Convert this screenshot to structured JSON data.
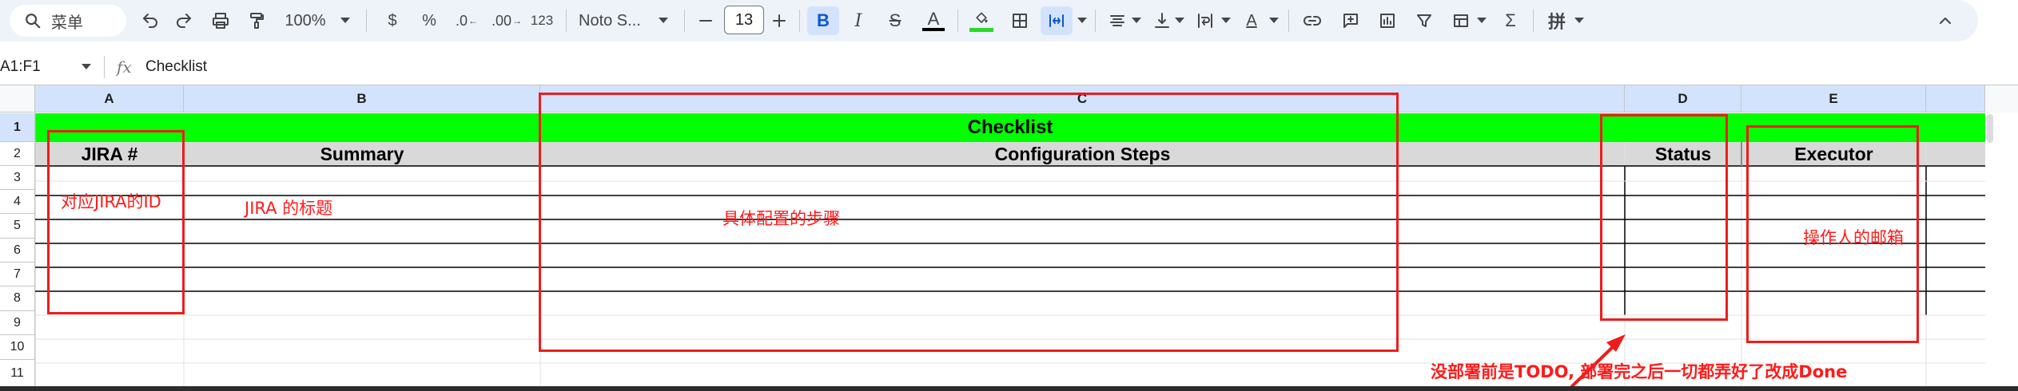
{
  "toolbar": {
    "menu_search_label": "菜单",
    "zoom": "100%",
    "currency": "$",
    "percent": "%",
    "decrease_decimal": ".0",
    "increase_decimal": ".00",
    "number_format": "123",
    "font_family": "Noto S...",
    "font_size": "13",
    "bold": "B",
    "italic": "I",
    "strikethrough": "S",
    "text_color": "A",
    "functions": "Σ",
    "input_tools": "拼"
  },
  "formula_bar": {
    "name_box": "A1:F1",
    "fx": "fx",
    "content": "Checklist"
  },
  "grid": {
    "columns": [
      "A",
      "B",
      "C",
      "D",
      "E"
    ],
    "rows": [
      "1",
      "2",
      "3",
      "4",
      "5",
      "6",
      "7",
      "8",
      "9",
      "10",
      "11"
    ],
    "title_cell": "Checklist",
    "headers": {
      "a": "JIRA #",
      "b": "Summary",
      "c": "Configuration Steps",
      "d": "Status",
      "e": "Executor"
    }
  },
  "annotations": {
    "jira_id": "对应JIRA的ID",
    "summary": "JIRA 的标题",
    "steps": "具体配置的步骤",
    "executor": "操作人的邮箱",
    "status_note": "没部署前是TODO, 部署完之后一切都弄好了改成Done"
  },
  "colors": {
    "title_fill": "#00ff00",
    "header_fill": "#d9d9d9",
    "annotation_red": "#ff1a1a",
    "selected_header": "#d3e3fd"
  }
}
